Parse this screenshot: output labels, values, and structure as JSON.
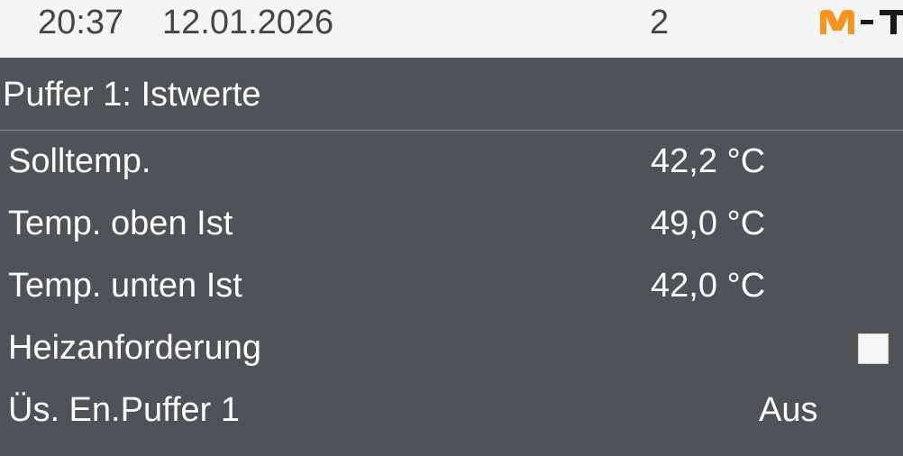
{
  "header": {
    "time": "20:37",
    "date": "12.01.2026",
    "page_number": "2",
    "logo": {
      "text": "M-T",
      "accent_color": "#f7931e",
      "dark_color": "#1a1a1a"
    }
  },
  "page": {
    "title": "Puffer 1: Istwerte"
  },
  "rows": [
    {
      "label": "Solltemp.",
      "value": "42,2 °C"
    },
    {
      "label": "Temp. oben Ist",
      "value": "49,0 °C"
    },
    {
      "label": "Temp. unten Ist",
      "value": "42,0 °C"
    },
    {
      "label": "Heizanforderung",
      "checked": false
    },
    {
      "label": "Üs. En.Puffer 1",
      "value": "Aus"
    }
  ],
  "colors": {
    "background": "#505356",
    "header_background": "#f4f4f4",
    "text": "#ffffff",
    "header_text": "#454545"
  }
}
